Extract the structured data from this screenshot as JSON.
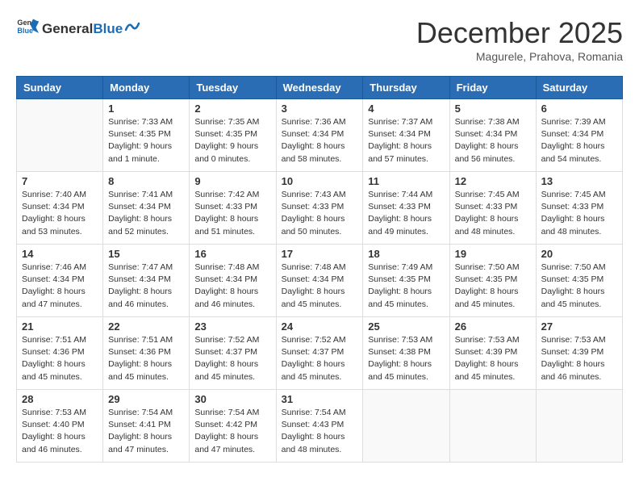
{
  "header": {
    "logo_general": "General",
    "logo_blue": "Blue",
    "month_title": "December 2025",
    "subtitle": "Magurele, Prahova, Romania"
  },
  "weekdays": [
    "Sunday",
    "Monday",
    "Tuesday",
    "Wednesday",
    "Thursday",
    "Friday",
    "Saturday"
  ],
  "weeks": [
    [
      {
        "day": "",
        "info": ""
      },
      {
        "day": "1",
        "info": "Sunrise: 7:33 AM\nSunset: 4:35 PM\nDaylight: 9 hours\nand 1 minute."
      },
      {
        "day": "2",
        "info": "Sunrise: 7:35 AM\nSunset: 4:35 PM\nDaylight: 9 hours\nand 0 minutes."
      },
      {
        "day": "3",
        "info": "Sunrise: 7:36 AM\nSunset: 4:34 PM\nDaylight: 8 hours\nand 58 minutes."
      },
      {
        "day": "4",
        "info": "Sunrise: 7:37 AM\nSunset: 4:34 PM\nDaylight: 8 hours\nand 57 minutes."
      },
      {
        "day": "5",
        "info": "Sunrise: 7:38 AM\nSunset: 4:34 PM\nDaylight: 8 hours\nand 56 minutes."
      },
      {
        "day": "6",
        "info": "Sunrise: 7:39 AM\nSunset: 4:34 PM\nDaylight: 8 hours\nand 54 minutes."
      }
    ],
    [
      {
        "day": "7",
        "info": "Sunrise: 7:40 AM\nSunset: 4:34 PM\nDaylight: 8 hours\nand 53 minutes."
      },
      {
        "day": "8",
        "info": "Sunrise: 7:41 AM\nSunset: 4:34 PM\nDaylight: 8 hours\nand 52 minutes."
      },
      {
        "day": "9",
        "info": "Sunrise: 7:42 AM\nSunset: 4:33 PM\nDaylight: 8 hours\nand 51 minutes."
      },
      {
        "day": "10",
        "info": "Sunrise: 7:43 AM\nSunset: 4:33 PM\nDaylight: 8 hours\nand 50 minutes."
      },
      {
        "day": "11",
        "info": "Sunrise: 7:44 AM\nSunset: 4:33 PM\nDaylight: 8 hours\nand 49 minutes."
      },
      {
        "day": "12",
        "info": "Sunrise: 7:45 AM\nSunset: 4:33 PM\nDaylight: 8 hours\nand 48 minutes."
      },
      {
        "day": "13",
        "info": "Sunrise: 7:45 AM\nSunset: 4:33 PM\nDaylight: 8 hours\nand 48 minutes."
      }
    ],
    [
      {
        "day": "14",
        "info": "Sunrise: 7:46 AM\nSunset: 4:34 PM\nDaylight: 8 hours\nand 47 minutes."
      },
      {
        "day": "15",
        "info": "Sunrise: 7:47 AM\nSunset: 4:34 PM\nDaylight: 8 hours\nand 46 minutes."
      },
      {
        "day": "16",
        "info": "Sunrise: 7:48 AM\nSunset: 4:34 PM\nDaylight: 8 hours\nand 46 minutes."
      },
      {
        "day": "17",
        "info": "Sunrise: 7:48 AM\nSunset: 4:34 PM\nDaylight: 8 hours\nand 45 minutes."
      },
      {
        "day": "18",
        "info": "Sunrise: 7:49 AM\nSunset: 4:35 PM\nDaylight: 8 hours\nand 45 minutes."
      },
      {
        "day": "19",
        "info": "Sunrise: 7:50 AM\nSunset: 4:35 PM\nDaylight: 8 hours\nand 45 minutes."
      },
      {
        "day": "20",
        "info": "Sunrise: 7:50 AM\nSunset: 4:35 PM\nDaylight: 8 hours\nand 45 minutes."
      }
    ],
    [
      {
        "day": "21",
        "info": "Sunrise: 7:51 AM\nSunset: 4:36 PM\nDaylight: 8 hours\nand 45 minutes."
      },
      {
        "day": "22",
        "info": "Sunrise: 7:51 AM\nSunset: 4:36 PM\nDaylight: 8 hours\nand 45 minutes."
      },
      {
        "day": "23",
        "info": "Sunrise: 7:52 AM\nSunset: 4:37 PM\nDaylight: 8 hours\nand 45 minutes."
      },
      {
        "day": "24",
        "info": "Sunrise: 7:52 AM\nSunset: 4:37 PM\nDaylight: 8 hours\nand 45 minutes."
      },
      {
        "day": "25",
        "info": "Sunrise: 7:53 AM\nSunset: 4:38 PM\nDaylight: 8 hours\nand 45 minutes."
      },
      {
        "day": "26",
        "info": "Sunrise: 7:53 AM\nSunset: 4:39 PM\nDaylight: 8 hours\nand 45 minutes."
      },
      {
        "day": "27",
        "info": "Sunrise: 7:53 AM\nSunset: 4:39 PM\nDaylight: 8 hours\nand 46 minutes."
      }
    ],
    [
      {
        "day": "28",
        "info": "Sunrise: 7:53 AM\nSunset: 4:40 PM\nDaylight: 8 hours\nand 46 minutes."
      },
      {
        "day": "29",
        "info": "Sunrise: 7:54 AM\nSunset: 4:41 PM\nDaylight: 8 hours\nand 47 minutes."
      },
      {
        "day": "30",
        "info": "Sunrise: 7:54 AM\nSunset: 4:42 PM\nDaylight: 8 hours\nand 47 minutes."
      },
      {
        "day": "31",
        "info": "Sunrise: 7:54 AM\nSunset: 4:43 PM\nDaylight: 8 hours\nand 48 minutes."
      },
      {
        "day": "",
        "info": ""
      },
      {
        "day": "",
        "info": ""
      },
      {
        "day": "",
        "info": ""
      }
    ]
  ]
}
